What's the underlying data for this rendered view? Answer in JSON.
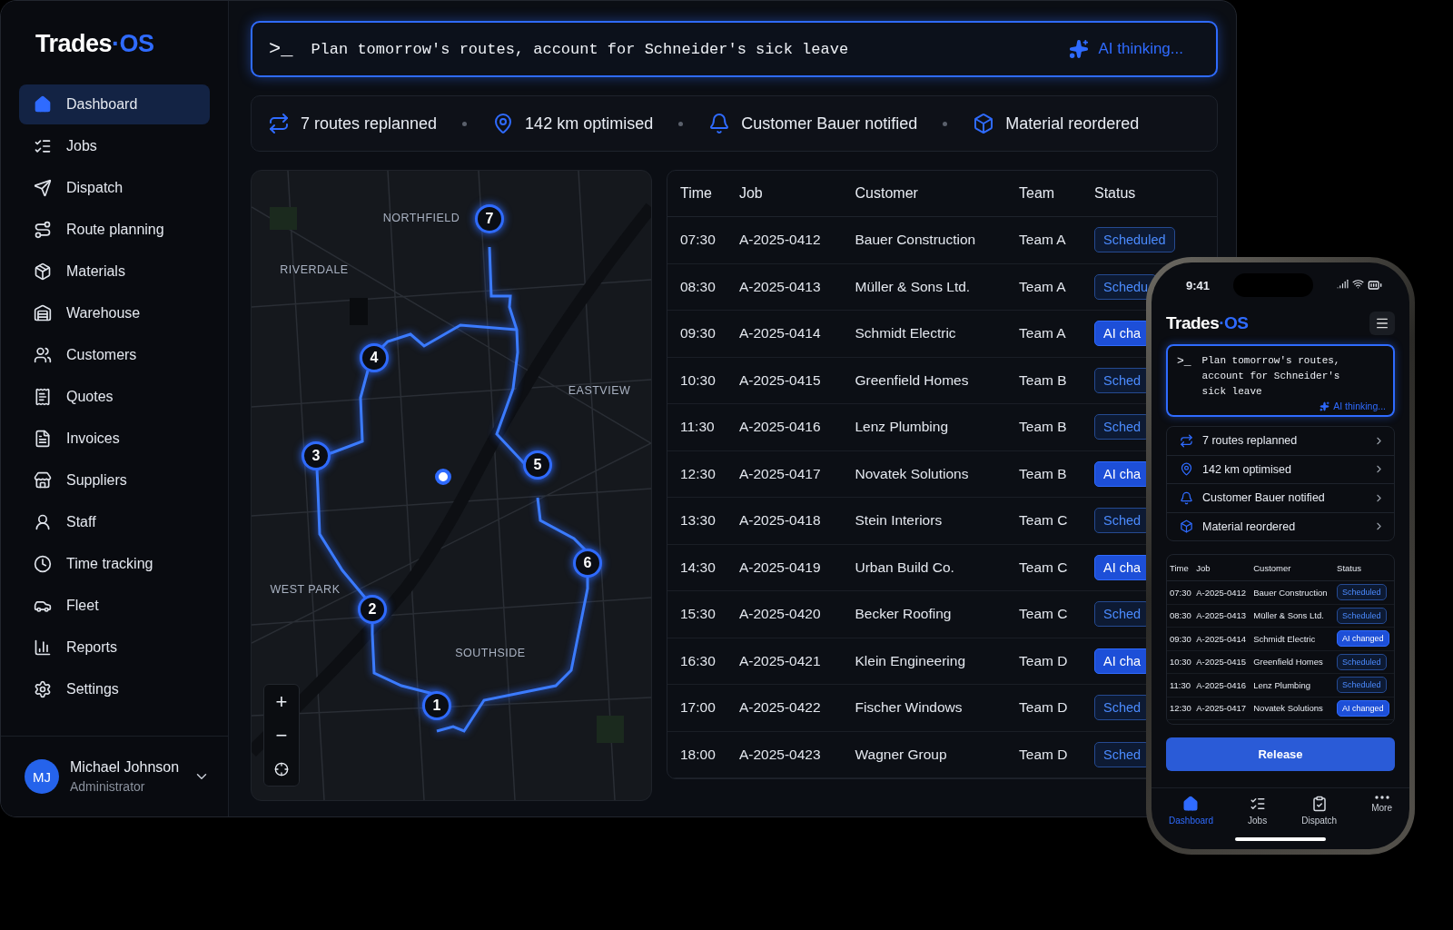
{
  "brand": {
    "name": "Trades",
    "accent": "·OS"
  },
  "sidebar": {
    "items": [
      {
        "label": "Dashboard",
        "selected": true
      },
      {
        "label": "Jobs",
        "selected": false
      },
      {
        "label": "Dispatch",
        "selected": false
      },
      {
        "label": "Route planning",
        "selected": false
      },
      {
        "label": "Materials",
        "selected": false
      },
      {
        "label": "Warehouse",
        "selected": false
      },
      {
        "label": "Customers",
        "selected": false
      },
      {
        "label": "Quotes",
        "selected": false
      },
      {
        "label": "Invoices",
        "selected": false
      },
      {
        "label": "Suppliers",
        "selected": false
      },
      {
        "label": "Staff",
        "selected": false
      },
      {
        "label": "Time tracking",
        "selected": false
      },
      {
        "label": "Fleet",
        "selected": false
      },
      {
        "label": "Reports",
        "selected": false
      },
      {
        "label": "Settings",
        "selected": false
      }
    ],
    "user": {
      "initials": "MJ",
      "name": "Michael Johnson",
      "role": "Administrator"
    }
  },
  "command": {
    "prompt": ">_",
    "value": "Plan tomorrow's routes, account for Schneider's sick leave",
    "status": "AI thinking..."
  },
  "summary": [
    "7 routes replanned",
    "142 km optimised",
    "Customer Bauer notified",
    "Material reordered"
  ],
  "map": {
    "districts": [
      "NORTHFIELD",
      "RIVERDALE",
      "EASTVIEW",
      "WEST PARK",
      "SOUTHSIDE"
    ],
    "stops": [
      "1",
      "2",
      "3",
      "4",
      "5",
      "6",
      "7"
    ],
    "controls": [
      "+",
      "−"
    ]
  },
  "table": {
    "columns": [
      "Time",
      "Job",
      "Customer",
      "Team",
      "Status"
    ],
    "rows": [
      {
        "time": "07:30",
        "job": "A-2025-0412",
        "customer": "Bauer Construction",
        "team": "Team A",
        "status": "Scheduled",
        "kind": "scheduled"
      },
      {
        "time": "08:30",
        "job": "A-2025-0413",
        "customer": "Müller & Sons Ltd.",
        "team": "Team A",
        "status": "Schedu",
        "kind": "scheduled"
      },
      {
        "time": "09:30",
        "job": "A-2025-0414",
        "customer": "Schmidt Electric",
        "team": "Team A",
        "status": "AI cha",
        "kind": "ai_changed"
      },
      {
        "time": "10:30",
        "job": "A-2025-0415",
        "customer": "Greenfield Homes",
        "team": "Team B",
        "status": "Sched",
        "kind": "scheduled"
      },
      {
        "time": "11:30",
        "job": "A-2025-0416",
        "customer": "Lenz Plumbing",
        "team": "Team B",
        "status": "Sched",
        "kind": "scheduled"
      },
      {
        "time": "12:30",
        "job": "A-2025-0417",
        "customer": "Novatek Solutions",
        "team": "Team B",
        "status": "AI cha",
        "kind": "ai_changed"
      },
      {
        "time": "13:30",
        "job": "A-2025-0418",
        "customer": "Stein Interiors",
        "team": "Team C",
        "status": "Sched",
        "kind": "scheduled"
      },
      {
        "time": "14:30",
        "job": "A-2025-0419",
        "customer": "Urban Build Co.",
        "team": "Team C",
        "status": "AI cha",
        "kind": "ai_changed"
      },
      {
        "time": "15:30",
        "job": "A-2025-0420",
        "customer": "Becker Roofing",
        "team": "Team C",
        "status": "Sched",
        "kind": "scheduled"
      },
      {
        "time": "16:30",
        "job": "A-2025-0421",
        "customer": "Klein Engineering",
        "team": "Team D",
        "status": "AI cha",
        "kind": "ai_changed"
      },
      {
        "time": "17:00",
        "job": "A-2025-0422",
        "customer": "Fischer Windows",
        "team": "Team D",
        "status": "Sched",
        "kind": "scheduled"
      },
      {
        "time": "18:00",
        "job": "A-2025-0423",
        "customer": "Wagner Group",
        "team": "Team D",
        "status": "Sched",
        "kind": "scheduled"
      }
    ]
  },
  "phone": {
    "clock": "9:41",
    "brand": {
      "name": "Trades",
      "accent": "·OS"
    },
    "command": {
      "prompt": ">_",
      "value": "Plan tomorrow's routes, account for Schneider's sick leave",
      "status": "AI thinking..."
    },
    "summary": [
      "7 routes replanned",
      "142 km optimised",
      "Customer Bauer notified",
      "Material reordered"
    ],
    "table": {
      "columns": [
        "Time",
        "Job",
        "Customer",
        "Status"
      ],
      "rows": [
        {
          "time": "07:30",
          "job": "A-2025-0412",
          "customer": "Bauer Construction",
          "status": "Scheduled",
          "kind": "scheduled"
        },
        {
          "time": "08:30",
          "job": "A-2025-0413",
          "customer": "Müller & Sons Ltd.",
          "status": "Scheduled",
          "kind": "scheduled"
        },
        {
          "time": "09:30",
          "job": "A-2025-0414",
          "customer": "Schmidt Electric",
          "status": "AI changed",
          "kind": "ai_changed"
        },
        {
          "time": "10:30",
          "job": "A-2025-0415",
          "customer": "Greenfield Homes",
          "status": "Scheduled",
          "kind": "scheduled"
        },
        {
          "time": "11:30",
          "job": "A-2025-0416",
          "customer": "Lenz Plumbing",
          "status": "Scheduled",
          "kind": "scheduled"
        },
        {
          "time": "12:30",
          "job": "A-2025-0417",
          "customer": "Novatek Solutions",
          "status": "AI changed",
          "kind": "ai_changed"
        }
      ]
    },
    "action": "Release",
    "tabs": [
      {
        "label": "Dashboard",
        "selected": true
      },
      {
        "label": "Jobs",
        "selected": false
      },
      {
        "label": "Dispatch",
        "selected": false
      },
      {
        "label": "More",
        "selected": false
      }
    ]
  }
}
